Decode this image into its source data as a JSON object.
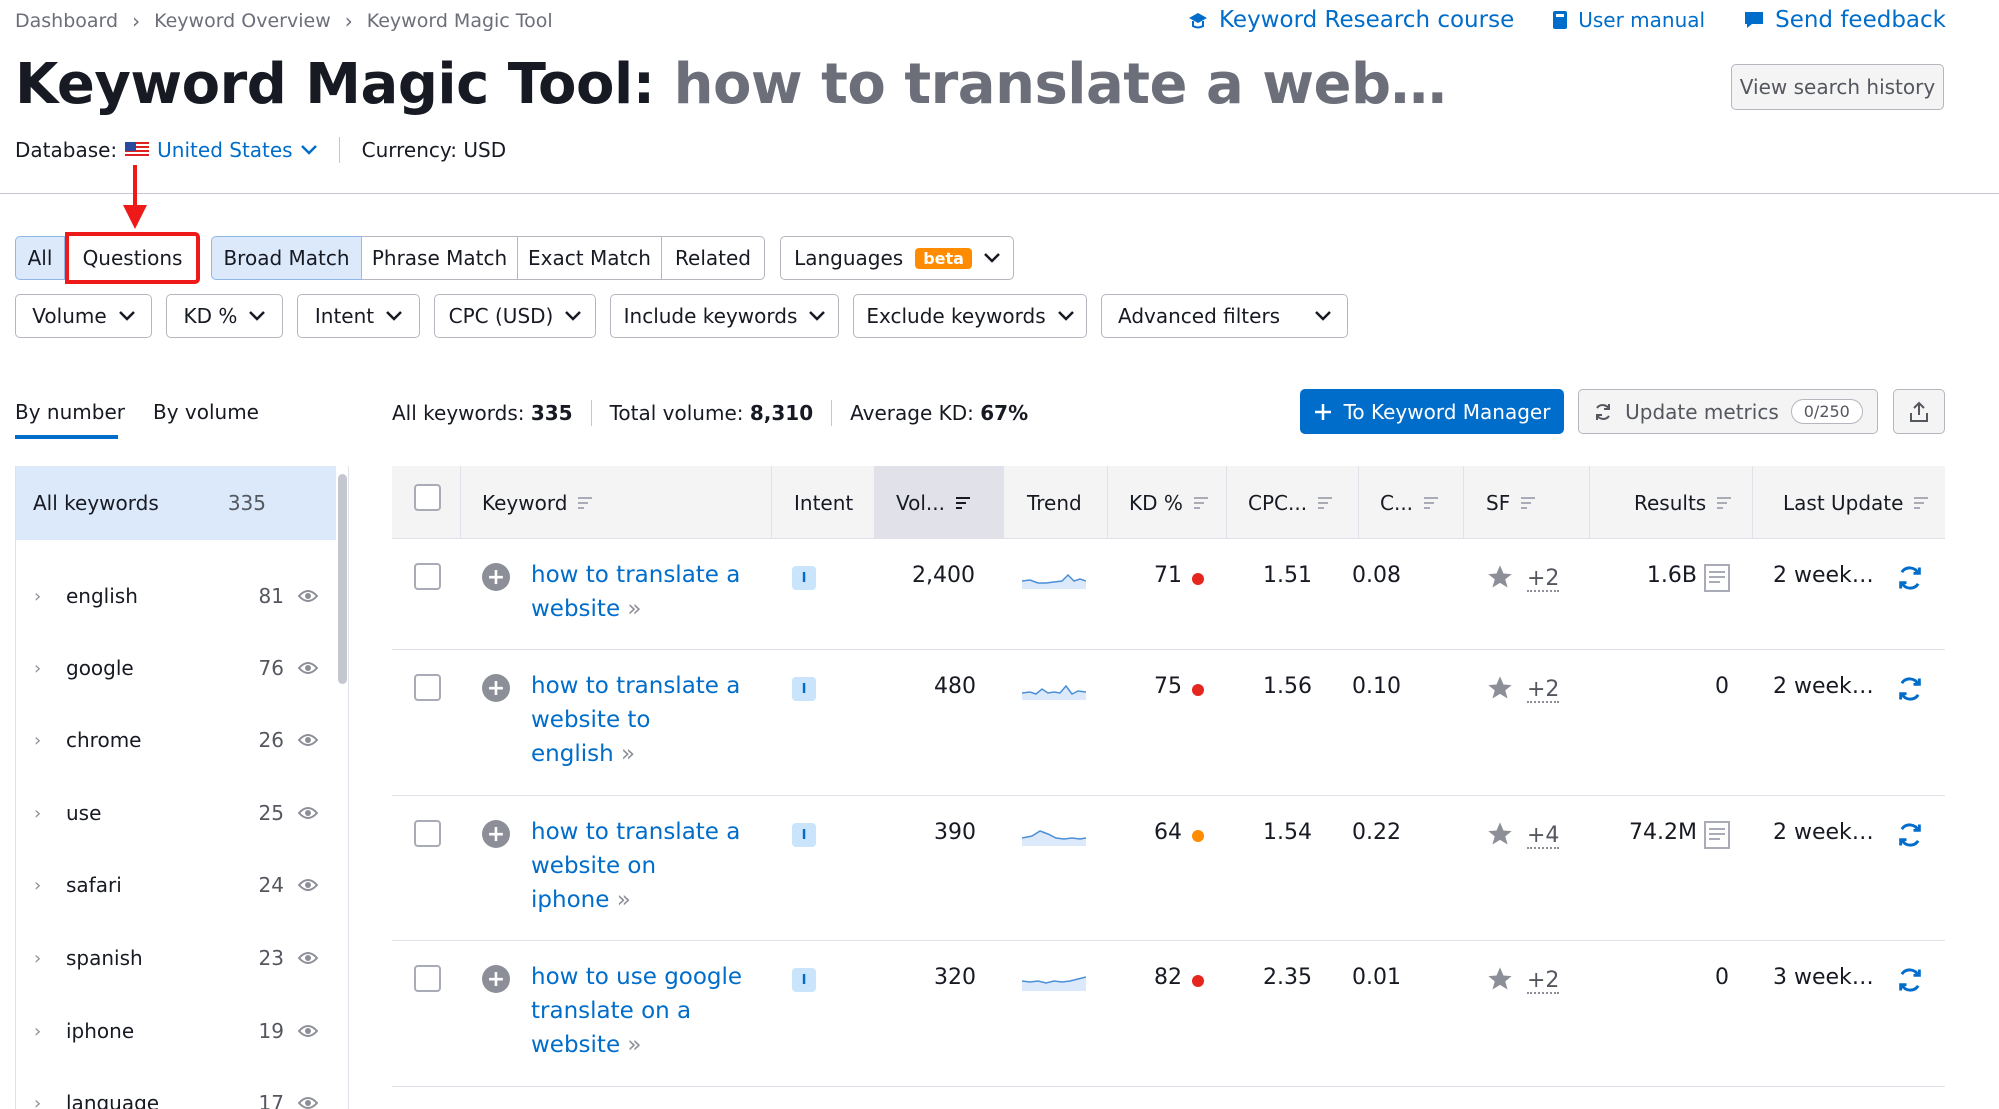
{
  "breadcrumb": [
    "Dashboard",
    "Keyword Overview",
    "Keyword Magic Tool"
  ],
  "top_links": {
    "course": "Keyword Research course",
    "manual": "User manual",
    "feedback": "Send feedback"
  },
  "title": {
    "tool": "Keyword Magic Tool:",
    "query": "how to translate a web…"
  },
  "view_history": "View search history",
  "database": {
    "label": "Database:",
    "country": "United States",
    "currency": "Currency: USD"
  },
  "match_tabs": {
    "all": "All",
    "questions": "Questions",
    "broad": "Broad Match",
    "phrase": "Phrase Match",
    "exact": "Exact Match",
    "related": "Related",
    "languages": "Languages",
    "beta": "beta"
  },
  "filters": {
    "volume": "Volume",
    "kd": "KD %",
    "intent": "Intent",
    "cpc": "CPC (USD)",
    "include": "Include keywords",
    "exclude": "Exclude keywords",
    "advanced": "Advanced filters"
  },
  "group_tabs": {
    "by_number": "By number",
    "by_volume": "By volume"
  },
  "summary": {
    "all_label": "All keywords:",
    "all_value": "335",
    "total_label": "Total volume:",
    "total_value": "8,310",
    "kd_label": "Average KD:",
    "kd_value": "67%"
  },
  "actions": {
    "to_km": "To Keyword Manager",
    "update": "Update metrics",
    "update_count": "0/250"
  },
  "sidebar": {
    "all_label": "All keywords",
    "all_count": "335",
    "items": [
      {
        "label": "english",
        "count": "81"
      },
      {
        "label": "google",
        "count": "76"
      },
      {
        "label": "chrome",
        "count": "26"
      },
      {
        "label": "use",
        "count": "25"
      },
      {
        "label": "safari",
        "count": "24"
      },
      {
        "label": "spanish",
        "count": "23"
      },
      {
        "label": "iphone",
        "count": "19"
      },
      {
        "label": "language",
        "count": "17"
      }
    ]
  },
  "table": {
    "headers": {
      "keyword": "Keyword",
      "intent": "Intent",
      "volume": "Vol...",
      "trend": "Trend",
      "kd": "KD %",
      "cpc": "CPC...",
      "com": "C...",
      "sf": "SF",
      "results": "Results",
      "last_update": "Last Update"
    },
    "rows": [
      {
        "kw1": "how to translate a",
        "kw2": "website",
        "kw3": "",
        "intent": "I",
        "volume": "2,400",
        "kd": "71",
        "kd_color": "#e5261f",
        "cpc": "1.51",
        "com": "0.08",
        "sf": "+2",
        "results": "1.6B",
        "last_update": "2 week…"
      },
      {
        "kw1": "how to translate a",
        "kw2": "website to",
        "kw3": "english",
        "intent": "I",
        "volume": "480",
        "kd": "75",
        "kd_color": "#e5261f",
        "cpc": "1.56",
        "com": "0.10",
        "sf": "+2",
        "results": "0",
        "last_update": "2 week…"
      },
      {
        "kw1": "how to translate a",
        "kw2": "website on",
        "kw3": "iphone",
        "intent": "I",
        "volume": "390",
        "kd": "64",
        "kd_color": "#ff8c00",
        "cpc": "1.54",
        "com": "0.22",
        "sf": "+4",
        "results": "74.2M",
        "last_update": "2 week…"
      },
      {
        "kw1": "how to use google",
        "kw2": "translate on a",
        "kw3": "website",
        "intent": "I",
        "volume": "320",
        "kd": "82",
        "kd_color": "#e5261f",
        "cpc": "2.35",
        "com": "0.01",
        "sf": "+2",
        "results": "0",
        "last_update": "3 week…"
      }
    ]
  }
}
